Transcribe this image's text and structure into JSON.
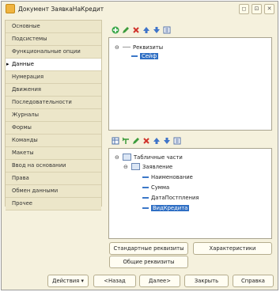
{
  "window": {
    "title": "Документ ЗаявкаНаКредит"
  },
  "window_buttons": [
    "◻",
    "⊡",
    "✕"
  ],
  "sidebar": {
    "items": [
      "Основные",
      "Подсистемы",
      "Функциональные опции",
      "Данные",
      "Нумерация",
      "Движения",
      "Последовательности",
      "Журналы",
      "Формы",
      "Команды",
      "Макеты",
      "Ввод на основании",
      "Права",
      "Обмен данными",
      "Прочее"
    ],
    "active_marker": "▸"
  },
  "attributes_tree": {
    "root": "Реквизиты",
    "children": [
      "Сейф"
    ],
    "selected": "Сейф"
  },
  "tabular_tree": {
    "root": "Табличные части",
    "table": "Заявление",
    "children": [
      "Наименование",
      "Сумма",
      "ДатаПостпления",
      "ВидКредита"
    ],
    "selected": "ВидКредита"
  },
  "buttons": {
    "standard_attributes": "Стандартные реквизиты",
    "characteristics": "Характеристики",
    "common_attributes": "Общие реквизиты"
  },
  "footer": {
    "actions": "Действия",
    "actions_arrow": "▾",
    "back": "<Назад",
    "next": "Далее>",
    "close": "Закрыть",
    "help": "Справка"
  }
}
